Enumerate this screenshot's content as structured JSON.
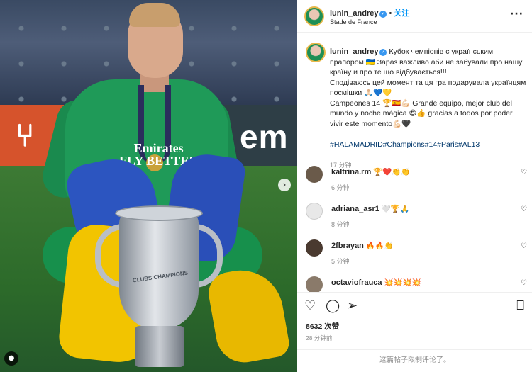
{
  "photo": {
    "banner_text": "em",
    "banner_fork": "⑂",
    "shirt_text": "Emirates\nFLY BETTER",
    "trophy_text": "CLUBS CHAMPIONS",
    "next_icon": "chevron-right-icon",
    "tag_icon": "person-tag-icon"
  },
  "header": {
    "username": "lunin_andrey",
    "separator": "•",
    "follow_label": "关注",
    "location": "Stade de France",
    "more_label": "···"
  },
  "caption": {
    "username": "lunin_andrey",
    "text": "Кубок чемпіонів с українським прапором 🇺🇦 Зараз важливо аби не забували про нашу країну и про те що відбувається!!!\nСподіваюсь цей момент та ця гра подарувала українцям посмішки 🙏🏻💙💛\nCampeones 14 🏆🇪🇸💪🏻 Grande equipo, mejor club del mundo y noche mágica 😍👍 gracias a todos por poder vivir este momento💪🏻🖤",
    "hashtags": "#HALAMADRID#Champions#14#Paris#AL13",
    "time": "17 分钟"
  },
  "comments": [
    {
      "username": "kaltrina.rm",
      "text": "🏆❤️👏👏",
      "time": "6 分钟"
    },
    {
      "username": "adriana_asr1",
      "text": "🤍🏆🙏",
      "time": "8 分钟"
    },
    {
      "username": "2fbrayan",
      "text": "🔥🔥👏",
      "time": "5 分钟"
    },
    {
      "username": "octaviofrauca",
      "text": "💥💥💥💥",
      "time": ""
    }
  ],
  "actions": {
    "like_icon": "heart-icon",
    "comment_icon": "comment-icon",
    "share_icon": "share-icon",
    "save_icon": "bookmark-icon"
  },
  "likes_text": "8632 次赞",
  "post_time": "28 分钟前",
  "comments_limited": "这篇帖子限制评论了。",
  "colors": {
    "accent": "#0095f6",
    "verified": "#3897f0",
    "hashtag": "#00376b",
    "muted": "#8e8e8e"
  }
}
